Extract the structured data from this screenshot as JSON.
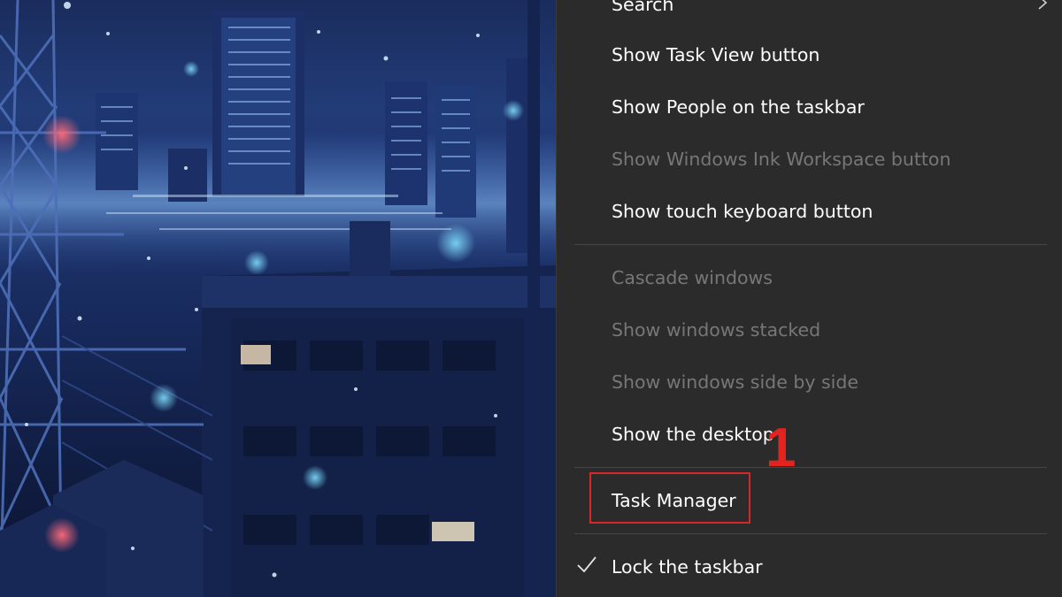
{
  "menu": {
    "items": [
      {
        "label": "Search",
        "has_submenu": true,
        "icon": "chevron-right-icon"
      },
      {
        "label": "Show Task View button"
      },
      {
        "label": "Show People on the taskbar"
      },
      {
        "label": "Show Windows Ink Workspace button",
        "disabled": true
      },
      {
        "label": "Show touch keyboard button"
      },
      {
        "label": "Cascade windows",
        "disabled": true
      },
      {
        "label": "Show windows stacked",
        "disabled": true
      },
      {
        "label": "Show windows side by side",
        "disabled": true
      },
      {
        "label": "Show the desktop"
      },
      {
        "label": "Task Manager",
        "highlighted": true
      },
      {
        "label": "Lock the taskbar",
        "checked": true,
        "icon": "checkmark-icon"
      }
    ]
  },
  "annotation": {
    "step_number": "1",
    "color": "#e2231e"
  },
  "colors": {
    "menu_background": "#2b2b2b",
    "enabled_text": "#ffffff",
    "disabled_text": "#777777",
    "highlight_border": "#d9262b"
  }
}
